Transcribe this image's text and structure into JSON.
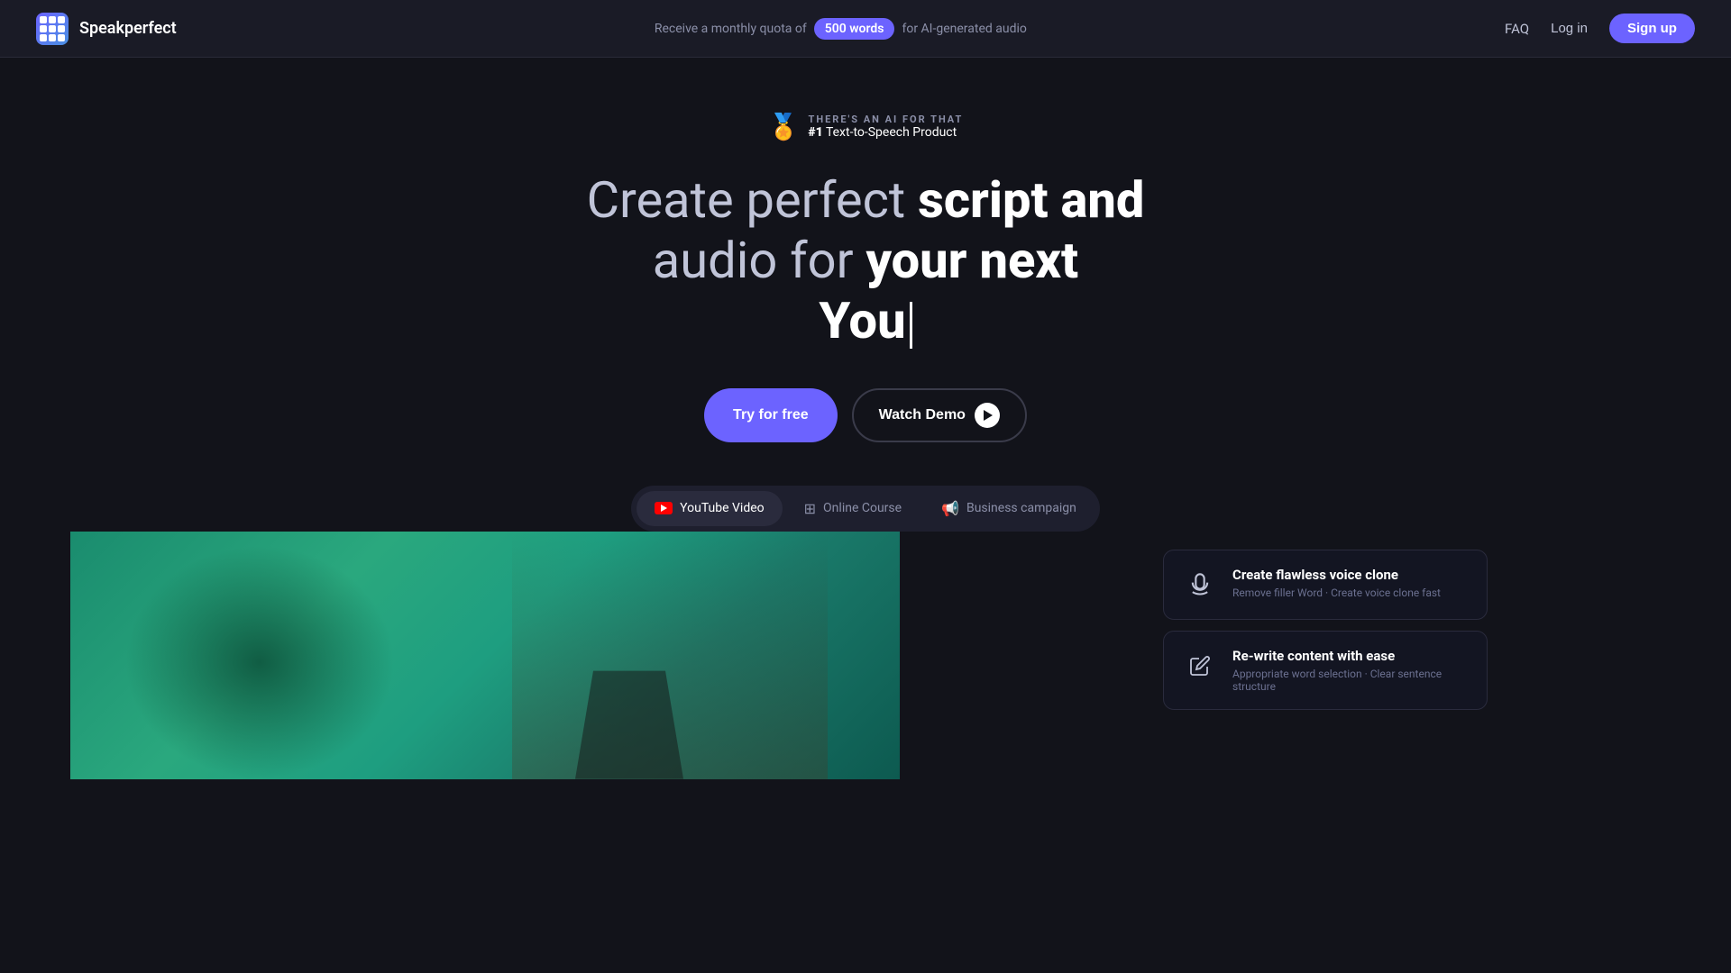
{
  "navbar": {
    "logo_text": "Speakperfect",
    "promo_prefix": "Receive a monthly quota of",
    "promo_words": "500 words",
    "promo_suffix": "for AI-generated audio",
    "faq_label": "FAQ",
    "login_label": "Log in",
    "signup_label": "Sign up"
  },
  "hero": {
    "award_top": "THERE'S AN AI FOR THAT",
    "award_bottom_bold": "#1",
    "award_bottom_text": " Text-to-Speech Product",
    "title_line1_normal": "Create perfect",
    "title_line1_bold": "script and",
    "title_line2_normal": "audio for",
    "title_line2_bold": "your next",
    "title_line3": "You",
    "try_label": "Try for free",
    "demo_label": "Watch Demo"
  },
  "tabs": [
    {
      "id": "youtube",
      "label": "YouTube Video",
      "active": true
    },
    {
      "id": "course",
      "label": "Online Course",
      "active": false
    },
    {
      "id": "business",
      "label": "Business campaign",
      "active": false
    }
  ],
  "features": [
    {
      "title": "Create flawless voice clone",
      "desc": "Remove filler Word · Create voice clone fast"
    },
    {
      "title": "Re-write content with ease",
      "desc": "Appropriate word selection · Clear sentence structure"
    }
  ]
}
